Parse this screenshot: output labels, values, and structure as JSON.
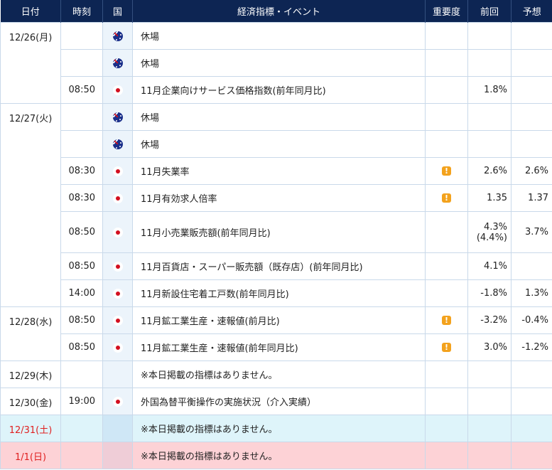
{
  "headers": {
    "date": "日付",
    "time": "時刻",
    "country": "国",
    "event": "経済指標・イベント",
    "importance": "重要度",
    "previous": "前回",
    "forecast": "予想"
  },
  "importance_mark": "!",
  "colors": {
    "header_bg": "#0d2553",
    "saturday_row": "#def4fa",
    "sunday_row": "#fdd2d6",
    "holiday_date_text": "#e02020",
    "importance_icon": "#f3a21d"
  },
  "days": [
    {
      "date": "12/26(月)",
      "rows": [
        {
          "time": "",
          "country": "australia-flag-icon",
          "event": "休場",
          "important": false,
          "previous": "",
          "previous_note": "",
          "forecast": ""
        },
        {
          "time": "",
          "country": "australia-flag-icon",
          "event": "休場",
          "important": false,
          "previous": "",
          "previous_note": "",
          "forecast": ""
        },
        {
          "time": "08:50",
          "country": "japan-flag-icon",
          "event": "11月企業向けサービス価格指数(前年同月比)",
          "important": false,
          "previous": "1.8%",
          "previous_note": "",
          "forecast": ""
        }
      ]
    },
    {
      "date": "12/27(火)",
      "rows": [
        {
          "time": "",
          "country": "australia-flag-icon",
          "event": "休場",
          "important": false,
          "previous": "",
          "previous_note": "",
          "forecast": ""
        },
        {
          "time": "",
          "country": "australia-flag-icon",
          "event": "休場",
          "important": false,
          "previous": "",
          "previous_note": "",
          "forecast": ""
        },
        {
          "time": "08:30",
          "country": "japan-flag-icon",
          "event": "11月失業率",
          "important": true,
          "previous": "2.6%",
          "previous_note": "",
          "forecast": "2.6%"
        },
        {
          "time": "08:30",
          "country": "japan-flag-icon",
          "event": "11月有効求人倍率",
          "important": true,
          "previous": "1.35",
          "previous_note": "",
          "forecast": "1.37"
        },
        {
          "time": "08:50",
          "country": "japan-flag-icon",
          "event": "11月小売業販売額(前年同月比)",
          "important": false,
          "previous": "4.3%",
          "previous_note": "(4.4%)",
          "forecast": "3.7%"
        },
        {
          "time": "08:50",
          "country": "japan-flag-icon",
          "event": "11月百貨店・スーパー販売額（既存店）(前年同月比)",
          "important": false,
          "previous": "4.1%",
          "previous_note": "",
          "forecast": ""
        },
        {
          "time": "14:00",
          "country": "japan-flag-icon",
          "event": "11月新設住宅着工戸数(前年同月比)",
          "important": false,
          "previous": "-1.8%",
          "previous_note": "",
          "forecast": "1.3%"
        }
      ]
    },
    {
      "date": "12/28(水)",
      "rows": [
        {
          "time": "08:50",
          "country": "japan-flag-icon",
          "event": "11月鉱工業生産・速報値(前月比)",
          "important": true,
          "previous": "-3.2%",
          "previous_note": "",
          "forecast": "-0.4%"
        },
        {
          "time": "08:50",
          "country": "japan-flag-icon",
          "event": "11月鉱工業生産・速報値(前年同月比)",
          "important": true,
          "previous": "3.0%",
          "previous_note": "",
          "forecast": "-1.2%"
        }
      ]
    },
    {
      "date": "12/29(木)",
      "rows": [
        {
          "time": "",
          "country": "",
          "event": "※本日掲載の指標はありません。",
          "important": false,
          "previous": "",
          "previous_note": "",
          "forecast": ""
        }
      ]
    },
    {
      "date": "12/30(金)",
      "rows": [
        {
          "time": "19:00",
          "country": "japan-flag-icon",
          "event": "外国為替平衡操作の実施状況（介入実績）",
          "important": false,
          "previous": "",
          "previous_note": "",
          "forecast": ""
        }
      ]
    },
    {
      "date": "12/31(土)",
      "day_type": "saturday",
      "rows": [
        {
          "time": "",
          "country": "",
          "event": "※本日掲載の指標はありません。",
          "important": false,
          "previous": "",
          "previous_note": "",
          "forecast": ""
        }
      ]
    },
    {
      "date": "1/1(日)",
      "day_type": "sunday",
      "rows": [
        {
          "time": "",
          "country": "",
          "event": "※本日掲載の指標はありません。",
          "important": false,
          "previous": "",
          "previous_note": "",
          "forecast": ""
        }
      ]
    }
  ]
}
